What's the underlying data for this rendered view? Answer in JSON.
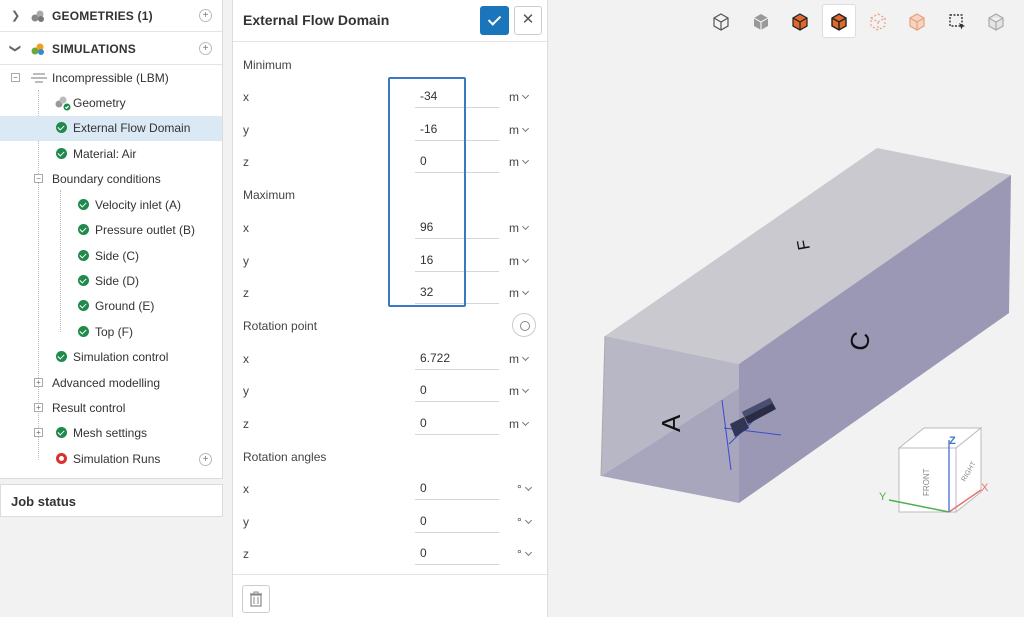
{
  "tree": {
    "geometries_label": "GEOMETRIES (1)",
    "simulations_label": "SIMULATIONS",
    "items": [
      {
        "label": "Incompressible (LBM)"
      },
      {
        "label": "Geometry"
      },
      {
        "label": "External Flow Domain"
      },
      {
        "label": "Material: Air"
      },
      {
        "label": "Boundary conditions"
      },
      {
        "label": "Velocity inlet (A)"
      },
      {
        "label": "Pressure outlet (B)"
      },
      {
        "label": "Side (C)"
      },
      {
        "label": "Side (D)"
      },
      {
        "label": "Ground (E)"
      },
      {
        "label": "Top (F)"
      },
      {
        "label": "Simulation control"
      },
      {
        "label": "Advanced modelling"
      },
      {
        "label": "Result control"
      },
      {
        "label": "Mesh settings"
      },
      {
        "label": "Simulation Runs"
      }
    ]
  },
  "job_status": "Job status",
  "panel": {
    "title": "External Flow Domain",
    "minimum_label": "Minimum",
    "maximum_label": "Maximum",
    "rotation_point_label": "Rotation point",
    "rotation_angles_label": "Rotation angles",
    "axis_x": "x",
    "axis_y": "y",
    "axis_z": "z",
    "minimum": {
      "x": "-34",
      "y": "-16",
      "z": "0",
      "unit": "m"
    },
    "maximum": {
      "x": "96",
      "y": "16",
      "z": "32",
      "unit": "m"
    },
    "rotation_point": {
      "x": "6.722",
      "y": "0",
      "z": "0",
      "unit": "m"
    },
    "rotation_angles": {
      "x": "0",
      "y": "0",
      "z": "0",
      "unit": "°"
    }
  },
  "viewport": {
    "face_labels": {
      "inlet": "A",
      "side": "C",
      "top": "F"
    },
    "view_cube": {
      "top": "Z",
      "front": "FRONT",
      "right": "RIGHT"
    },
    "triad": {
      "x": "X",
      "y": "Y"
    },
    "colors": {
      "accent": "#1b75bb",
      "domain_top": "#c9c9cf",
      "domain_side": "#9a98b4",
      "check_green": "#1f8a4c",
      "error_red": "#d9312b",
      "highlight": "#3a78c3"
    }
  }
}
